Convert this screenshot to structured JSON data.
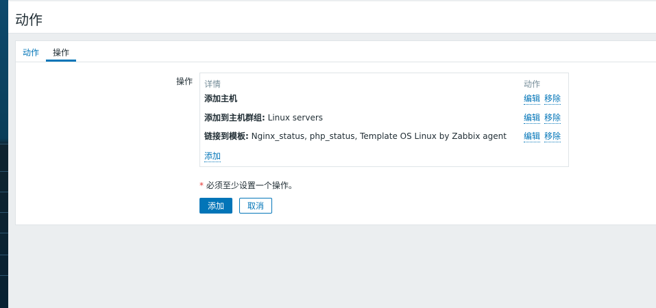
{
  "page": {
    "title": "动作"
  },
  "tabs": [
    {
      "label": "动作",
      "active": false
    },
    {
      "label": "操作",
      "active": true
    }
  ],
  "operations": {
    "label": "操作",
    "header_details": "详情",
    "header_actions": "动作",
    "rows": [
      {
        "bold": "添加主机",
        "rest": "",
        "edit": "编辑",
        "remove": "移除"
      },
      {
        "bold": "添加到主机群组:",
        "rest": " Linux servers",
        "edit": "编辑",
        "remove": "移除"
      },
      {
        "bold": "链接到模板:",
        "rest": " Nginx_status, php_status, Template OS Linux by Zabbix agent",
        "edit": "编辑",
        "remove": "移除"
      }
    ],
    "add_link": "添加"
  },
  "required": {
    "star": "*",
    "text": " 必须至少设置一个操作。"
  },
  "buttons": {
    "add": "添加",
    "cancel": "取消"
  },
  "colors": {
    "accent": "#0275b8",
    "required": "#e33734",
    "sidebar": "#0e4a6d"
  }
}
